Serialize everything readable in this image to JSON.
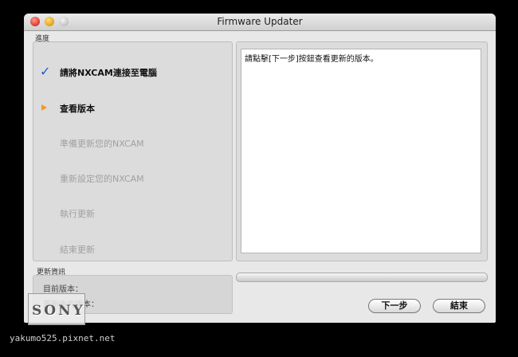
{
  "window": {
    "title": "Firmware Updater"
  },
  "progress_section": {
    "label": "進度"
  },
  "steps": [
    {
      "label": "請將NXCAM連接至電腦",
      "state": "done",
      "icon": "checkmark-icon"
    },
    {
      "label": "查看版本",
      "state": "current",
      "icon": "arrow-icon"
    },
    {
      "label": "準備更新您的NXCAM",
      "state": "pending"
    },
    {
      "label": "重新設定您的NXCAM",
      "state": "pending"
    },
    {
      "label": "執行更新",
      "state": "pending"
    },
    {
      "label": "結束更新",
      "state": "pending"
    }
  ],
  "message": {
    "text": "請點擊[下一步]按鈕查看更新的版本。"
  },
  "update_info": {
    "label": "更新資訊",
    "current_version_label": "目前版本：",
    "new_version_label": "更新後的版本："
  },
  "buttons": {
    "next": "下一步",
    "finish": "結束"
  },
  "watermark": {
    "brand": "SONY",
    "site": "yakumo525.pixnet.net"
  },
  "colors": {
    "check": "#1a5fd0",
    "arrow": "#f09a2a"
  }
}
